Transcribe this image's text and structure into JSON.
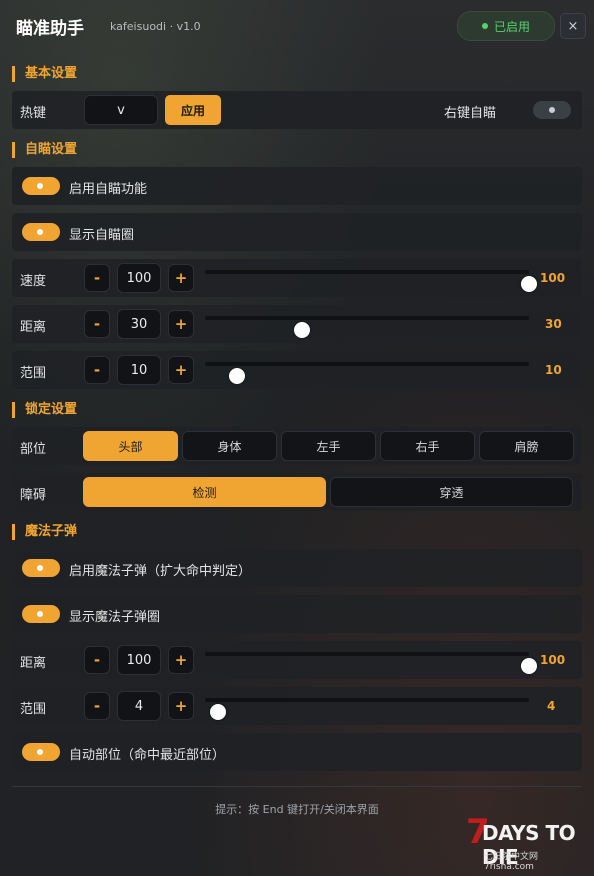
{
  "header": {
    "title": "瞄准助手",
    "subtitle": "kafeisuodi · v1.0",
    "status": "已启用",
    "close": "×"
  },
  "colors": {
    "accent": "#f0a533",
    "status_green": "#58d16a",
    "background": "#1c1e21"
  },
  "basic": {
    "title": "基本设置",
    "hotkey_label": "热键",
    "hotkey_value": "v",
    "apply_label": "应用",
    "right_aim_label": "右键自瞄",
    "right_aim_enabled": false
  },
  "aim": {
    "title": "自瞄设置",
    "enable_label": "启用自瞄功能",
    "enable_on": true,
    "show_circle_label": "显示自瞄圈",
    "show_circle_on": true,
    "sliders": [
      {
        "label": "速度",
        "value": "100",
        "display": "100",
        "min": 0,
        "max": 100
      },
      {
        "label": "距离",
        "value": "30",
        "display": "30",
        "min": 0,
        "max": 100
      },
      {
        "label": "范围",
        "value": "10",
        "display": "10",
        "min": 0,
        "max": 100
      }
    ]
  },
  "lock": {
    "title": "锁定设置",
    "part_label": "部位",
    "parts": [
      "头部",
      "身体",
      "左手",
      "右手",
      "肩膀"
    ],
    "part_selected": "头部",
    "obstacle_label": "障碍",
    "obstacle_options": [
      "检测",
      "穿透"
    ],
    "obstacle_selected": "检测"
  },
  "magic": {
    "title": "魔法子弹",
    "enable_label": "启用魔法子弹（扩大命中判定）",
    "enable_on": true,
    "show_circle_label": "显示魔法子弹圈",
    "show_circle_on": true,
    "sliders": [
      {
        "label": "距离",
        "value": "100",
        "display": "100",
        "min": 0,
        "max": 100
      },
      {
        "label": "范围",
        "value": "4",
        "display": "4",
        "min": 0,
        "max": 100
      }
    ],
    "auto_part_label": "自动部位（命中最近部位）",
    "auto_part_on": true
  },
  "footer": {
    "hint": "提示：按 End 键打开/关闭本界面"
  },
  "logo": {
    "main": "DAYS TO DIE",
    "seven": "7",
    "sub": "七日杀中文网 7risha.com"
  },
  "icons": {
    "stepper_minus": "-",
    "stepper_plus": "+"
  }
}
